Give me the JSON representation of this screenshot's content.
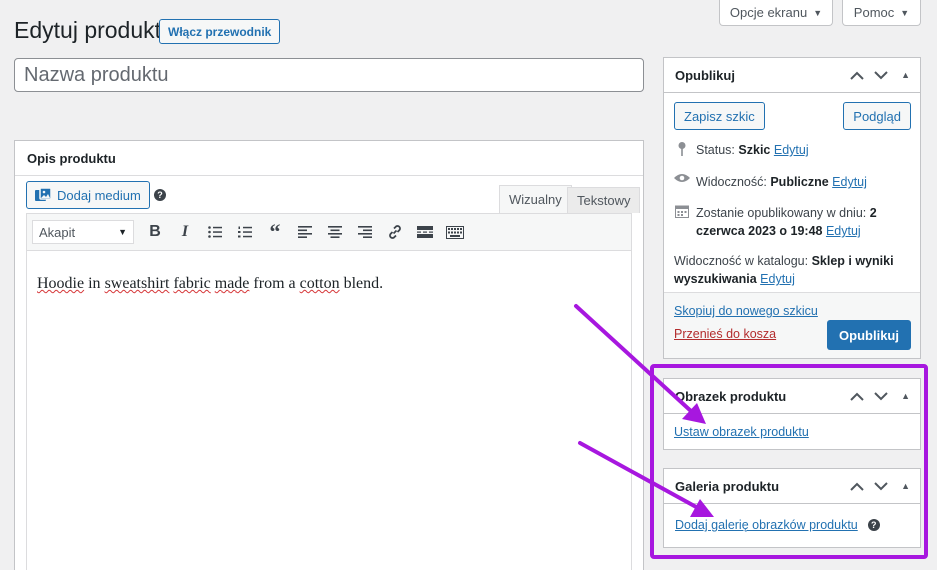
{
  "screen_options": {
    "label": "Opcje ekranu"
  },
  "help": {
    "label": "Pomoc"
  },
  "page": {
    "title": "Edytuj produkt",
    "guide_button": "Włącz przewodnik"
  },
  "product_name": {
    "placeholder": "Nazwa produktu"
  },
  "description": {
    "header": "Opis produktu",
    "add_media": "Dodaj medium",
    "tabs": {
      "visual": "Wizualny",
      "text": "Tekstowy"
    },
    "format_select": "Akapit",
    "content": {
      "w1": "Hoodie",
      "w2": "in",
      "w3": "sweatshirt",
      "w4": "fabric",
      "w5": "made",
      "w6": "from a",
      "w7": "cotton",
      "w8": "blend."
    }
  },
  "publish": {
    "title": "Opublikuj",
    "save_draft": "Zapisz szkic",
    "preview": "Podgląd",
    "status_label": "Status:",
    "status_value": "Szkic",
    "visibility_label": "Widoczność:",
    "visibility_value": "Publiczne",
    "publish_date_label": "Zostanie opublikowany w dniu:",
    "publish_date_value": "2 czerwca 2023 o 19:48",
    "catalog_label": "Widoczność w katalogu:",
    "catalog_value": "Sklep i wyniki wyszukiwania",
    "edit": "Edytuj",
    "copy_draft": "Skopiuj do nowego szkicu",
    "trash": "Przenieś do kosza",
    "publish_button": "Opublikuj"
  },
  "product_image": {
    "title": "Obrazek produktu",
    "link": "Ustaw obrazek produktu"
  },
  "product_gallery": {
    "title": "Galeria produktu",
    "link": "Dodaj galerię obrazków produktu"
  },
  "colors": {
    "highlight": "#a717df",
    "primary": "#2271b1",
    "danger": "#b32d2e"
  }
}
